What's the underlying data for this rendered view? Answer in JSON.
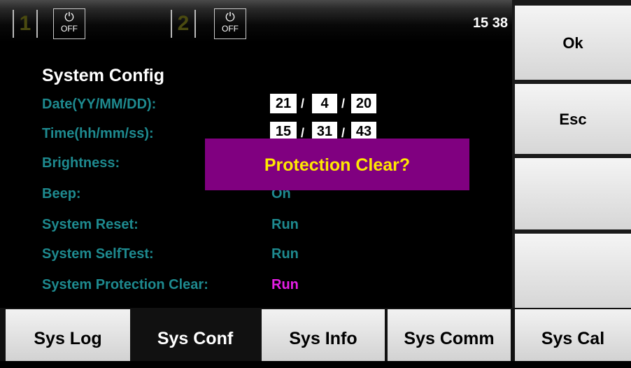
{
  "status_bar": {
    "channel1": {
      "number": "1",
      "power_state": "OFF",
      "power_symbol": "⏻"
    },
    "channel2": {
      "number": "2",
      "power_state": "OFF",
      "power_symbol": "⏻"
    },
    "clock": "15 38"
  },
  "config": {
    "title": "System Config",
    "date_label": "Date(YY/MM/DD):",
    "date": {
      "yy": "21",
      "mm": "4",
      "dd": "20"
    },
    "time_label": "Time(hh/mm/ss):",
    "time": {
      "hh": "15",
      "mm": "31",
      "ss": "43"
    },
    "separator": "/",
    "brightness_label": "Brightness:",
    "beep_label": "Beep:",
    "beep_value": "On",
    "reset_label": "System Reset:",
    "reset_value": "Run",
    "selftest_label": "System SelfTest:",
    "selftest_value": "Run",
    "protection_label": "System Protection Clear:",
    "protection_value": "Run"
  },
  "popup": {
    "message": "Protection Clear?"
  },
  "softkeys": {
    "ok": "Ok",
    "esc": "Esc",
    "key3": "",
    "key4": "",
    "key5": "Sys Cal"
  },
  "tabs": [
    {
      "label": "Sys Log",
      "selected": false
    },
    {
      "label": "Sys Conf",
      "selected": true
    },
    {
      "label": "Sys Info",
      "selected": false
    },
    {
      "label": "Sys Comm",
      "selected": false
    }
  ],
  "colors": {
    "label": "#1e8a8f",
    "highlight": "#e61ee6",
    "popup_bg": "#800080",
    "popup_text": "#ffe800"
  }
}
